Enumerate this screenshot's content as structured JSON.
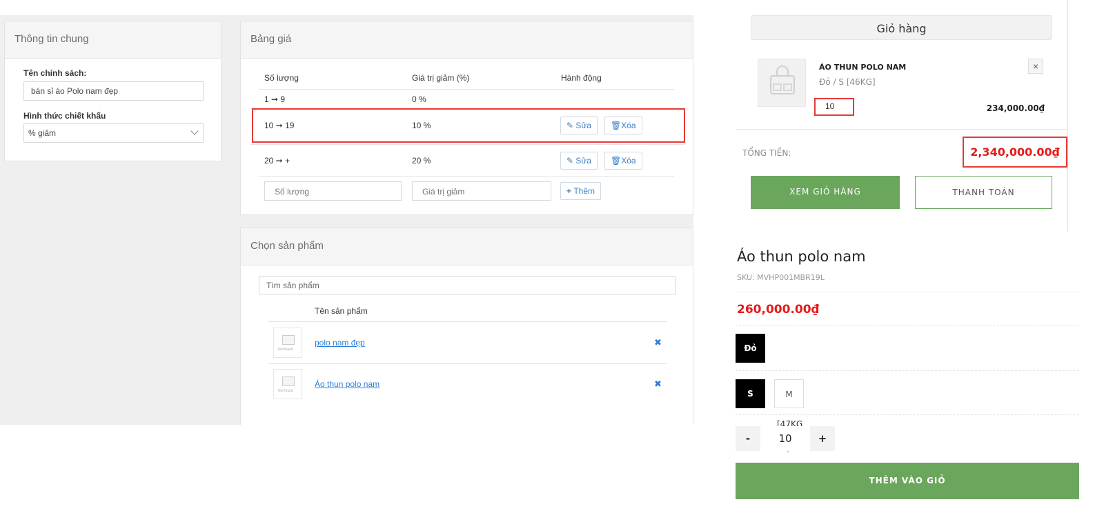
{
  "general": {
    "title": "Thông tin chung",
    "policy_label": "Tên chính sách:",
    "policy_value": "bán sỉ áo Polo nam đẹp",
    "discount_type_label": "Hình thức chiết khấu",
    "discount_type_value": "% giảm"
  },
  "price_table": {
    "title": "Bảng giá",
    "headers": [
      "Số lượng",
      "Giá trị giảm (%)",
      "Hành động"
    ],
    "rows": [
      {
        "qty": "1 ➞ 9",
        "discount": "0 %",
        "edit": "",
        "delete": ""
      },
      {
        "qty": "10 ➞ 19",
        "discount": "10 %",
        "edit": "Sửa",
        "delete": "Xóa"
      },
      {
        "qty": "20 ➞ +",
        "discount": "20 %",
        "edit": "Sửa",
        "delete": "Xóa"
      }
    ],
    "qty_placeholder": "Số lượng",
    "discount_placeholder": "Giá trị giảm",
    "add_label": "Thêm"
  },
  "products_panel": {
    "title": "Chọn sản phẩm",
    "search_placeholder": "Tìm sản phẩm",
    "column_header": "Tên sản phẩm",
    "items": [
      {
        "name": "polo nam đẹp"
      },
      {
        "name": "Áo thun polo nam"
      }
    ],
    "not_found_text": "Not found"
  },
  "cart": {
    "title": "Giỏ hàng",
    "item_name": "ÁO THUN POLO NAM",
    "item_variant": "Đỏ / S [46KG]",
    "item_qty": "10",
    "item_price": "234,000.00₫",
    "close_symbol": "×",
    "total_label": "TỔNG TIỀN:",
    "total_value": "2,340,000.00₫",
    "view_cart_label": "XEM GIỎ HÀNG",
    "checkout_label": "THANH TOÁN"
  },
  "product": {
    "name": "Áo thun polo nam",
    "sku": "SKU: MVHP001MBR19L",
    "price": "260,000.00₫",
    "color_option": "Đỏ",
    "size_options": [
      "S",
      "M"
    ],
    "weight_fragment": "[47KG",
    "qty_minus": "-",
    "qty_value": "10",
    "qty_plus": "+",
    "qty_below": "-",
    "add_to_cart_label": "THÊM VÀO GIỎ"
  },
  "colors": {
    "highlight_red": "#e53935",
    "price_red": "#e51a1a",
    "brand_green": "#6aa65c",
    "link_blue": "#2d7ed6"
  }
}
